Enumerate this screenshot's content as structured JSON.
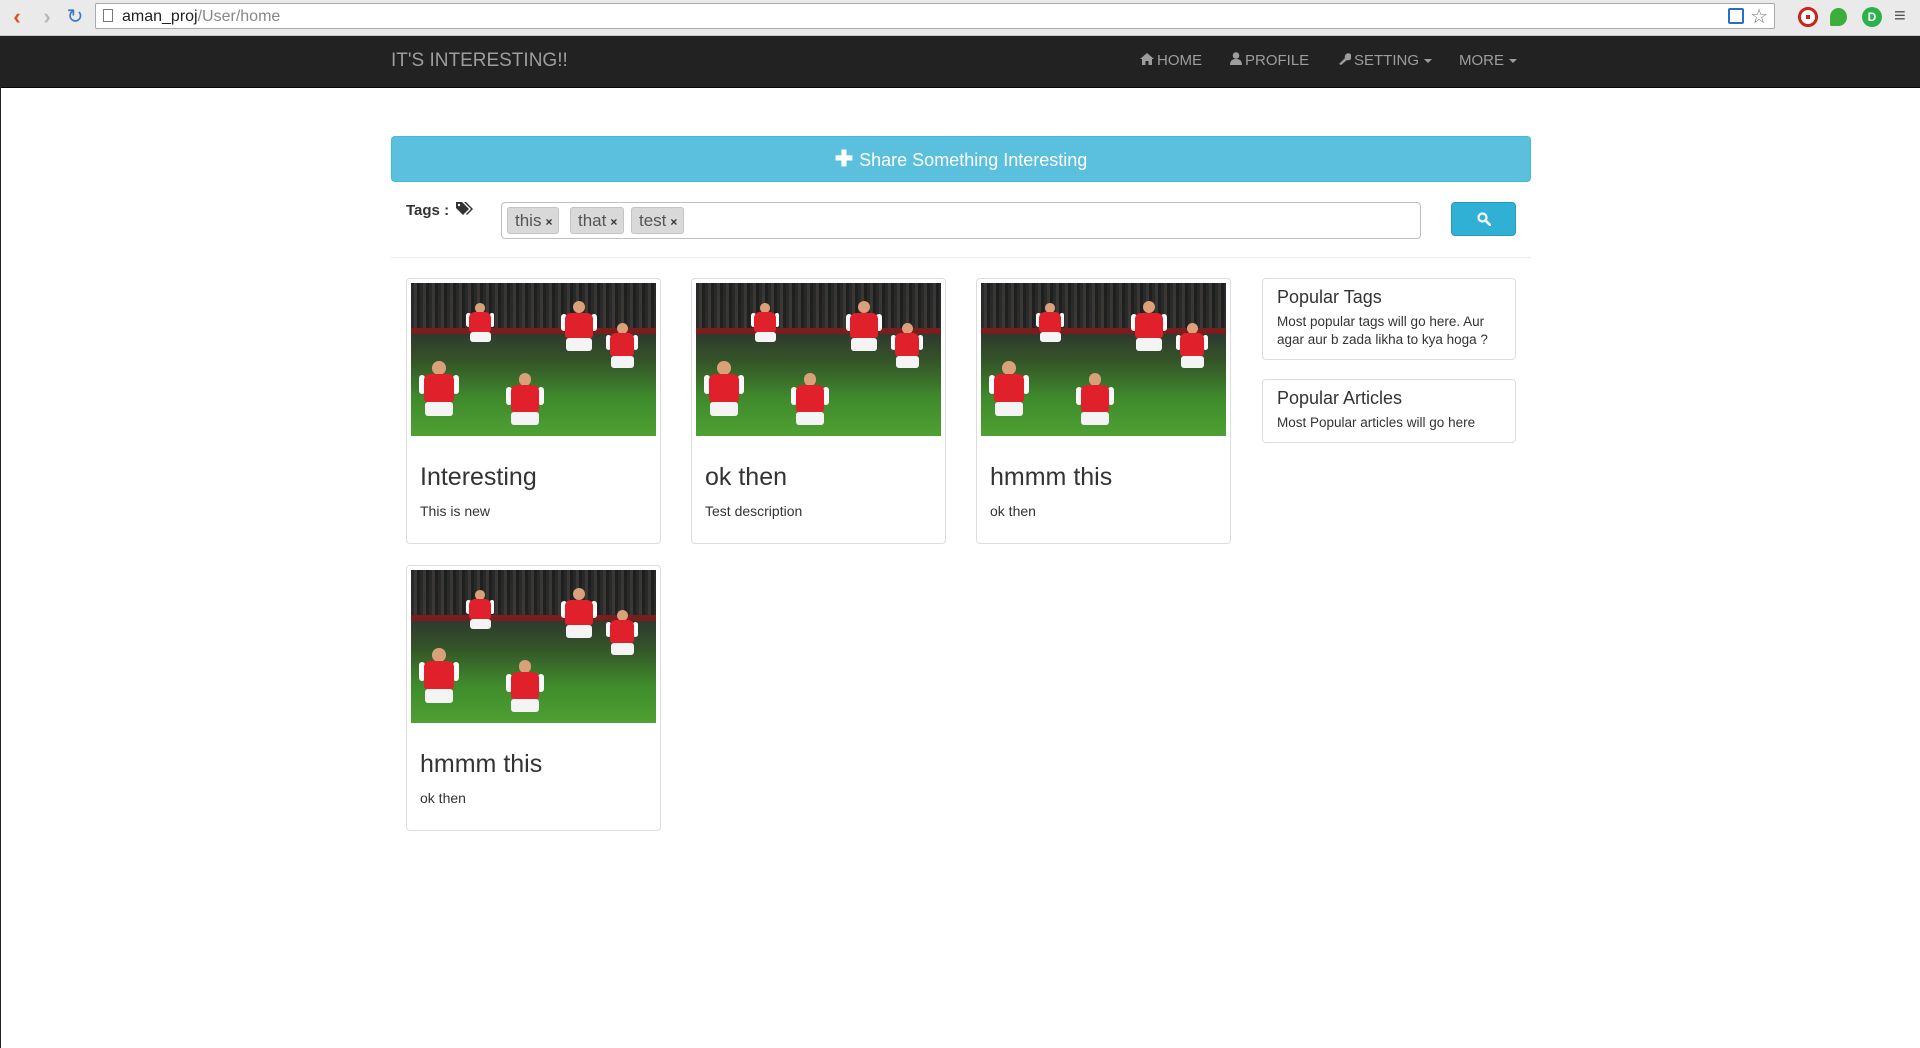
{
  "browser": {
    "url_host": "aman_proj",
    "url_path": "/User/home",
    "back_icon": "back-arrow-icon",
    "forward_icon": "forward-arrow-icon",
    "reload_icon": "reload-icon",
    "star_icon": "bookmark-star-icon",
    "ext_green_label": "D"
  },
  "navbar": {
    "brand": "IT'S INTERESTING!!",
    "items": [
      {
        "label": "HOME",
        "icon": "home-icon"
      },
      {
        "label": "PROFILE",
        "icon": "user-icon"
      },
      {
        "label": "SETTING",
        "icon": "wrench-icon"
      },
      {
        "label": "MORE",
        "icon": ""
      }
    ]
  },
  "share": {
    "label": "Share Something Interesting",
    "icon": "plus-icon"
  },
  "tags": {
    "label": "Tags :",
    "icon": "tags-icon",
    "chips": [
      "this",
      "that",
      "test"
    ],
    "remove_glyph": "×"
  },
  "cards": [
    {
      "title": "Interesting",
      "description": "This is new"
    },
    {
      "title": "ok then",
      "description": "Test description"
    },
    {
      "title": "hmmm this",
      "description": "ok then"
    },
    {
      "title": "hmmm this",
      "description": "ok then"
    }
  ],
  "sidebar": {
    "popular_tags": {
      "title": "Popular Tags",
      "text": "Most popular tags will go here. Aur agar aur b zada likha to kya hoga ?"
    },
    "popular_articles": {
      "title": "Popular Articles",
      "text": "Most Popular articles will go here"
    }
  },
  "colors": {
    "navbar_bg": "#222222",
    "share_bg": "#5bc0de",
    "search_bg": "#31b0d5",
    "jersey_red": "#e0202a"
  }
}
